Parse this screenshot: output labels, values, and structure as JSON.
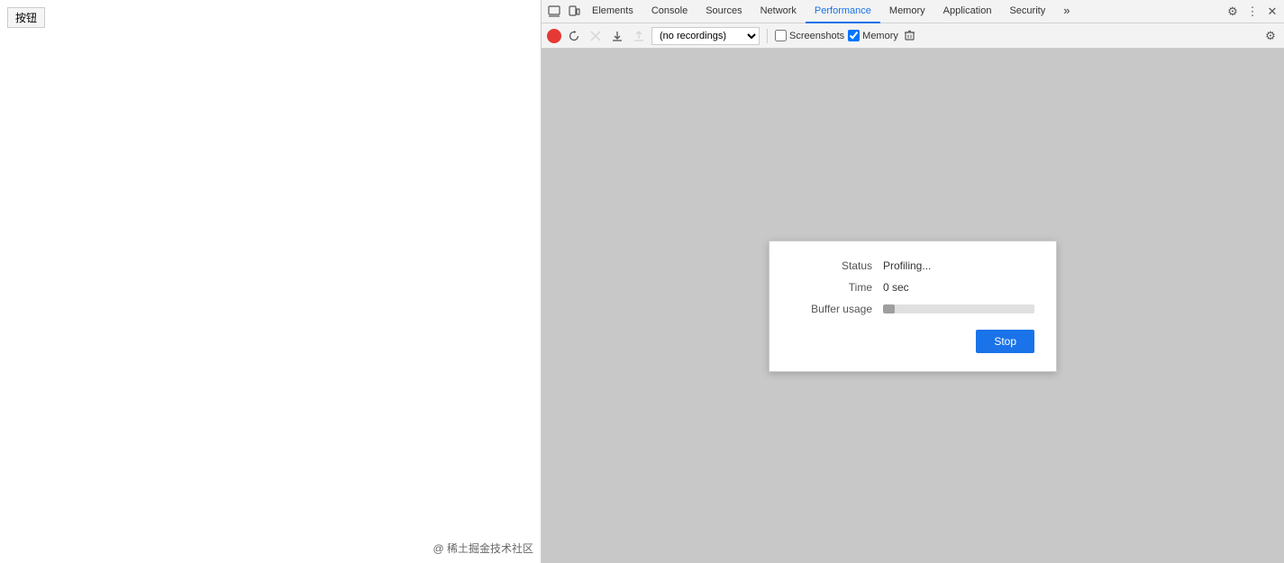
{
  "page": {
    "button_label": "按钮",
    "watermark": "@ 稀土掘金技术社区"
  },
  "devtools": {
    "tabs": [
      {
        "id": "elements",
        "label": "Elements",
        "active": false
      },
      {
        "id": "console",
        "label": "Console",
        "active": false
      },
      {
        "id": "sources",
        "label": "Sources",
        "active": false
      },
      {
        "id": "network",
        "label": "Network",
        "active": false
      },
      {
        "id": "performance",
        "label": "Performance",
        "active": true
      },
      {
        "id": "memory",
        "label": "Memory",
        "active": false
      },
      {
        "id": "application",
        "label": "Application",
        "active": false
      },
      {
        "id": "security",
        "label": "Security",
        "active": false
      }
    ],
    "toolbar": {
      "recordings_placeholder": "(no recordings)",
      "screenshots_label": "Screenshots",
      "memory_label": "Memory"
    },
    "dialog": {
      "status_label": "Status",
      "status_value": "Profiling...",
      "time_label": "Time",
      "time_value": "0 sec",
      "buffer_label": "Buffer usage",
      "buffer_fill_percent": 8,
      "stop_label": "Stop"
    }
  }
}
